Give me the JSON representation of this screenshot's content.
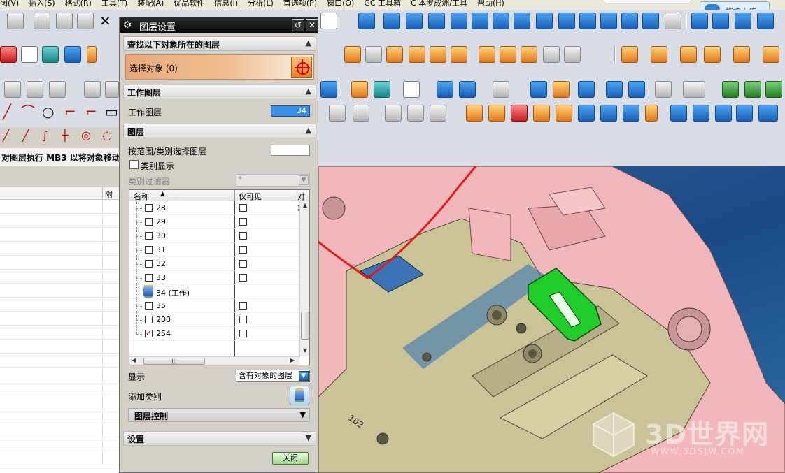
{
  "menubar": {
    "items": [
      "图(V)",
      "插入(S)",
      "格式(R)",
      "工具(T)",
      "装配(A)",
      "优品软件",
      "信息(I)",
      "分析(L)",
      "首选项(P)",
      "窗口(O)",
      "GC 工具箱",
      "C 本罗成洲/工具",
      "帮助(H)"
    ]
  },
  "upload_button": {
    "label": "拖拽上传"
  },
  "status_strip": {
    "text": "对图层执行 MB3 以将对象移动"
  },
  "navigator": {
    "column_label": "附"
  },
  "dialog": {
    "title": "图层设置",
    "section_find": {
      "label": "查找以下对象所在的图层",
      "select_label": "选择对象 (0)"
    },
    "section_work": {
      "label": "工作图层",
      "work_layer_label": "工作图层",
      "work_layer_value": "34"
    },
    "section_layer": {
      "label": "图层",
      "range_label": "按范围/类别选择图层",
      "category_display_label": "类别显示",
      "category_filter_label": "类别过滤器",
      "category_filter_value": "*",
      "columns": {
        "name": "名称",
        "visible_only": "仅可见",
        "objects": "对象"
      },
      "rows": [
        {
          "name": "28",
          "checked": false,
          "visible_only": false
        },
        {
          "name": "29",
          "checked": false,
          "visible_only": false
        },
        {
          "name": "30",
          "checked": false,
          "visible_only": false
        },
        {
          "name": "31",
          "checked": false,
          "visible_only": false
        },
        {
          "name": "32",
          "checked": false,
          "visible_only": false
        },
        {
          "name": "33",
          "checked": false,
          "visible_only": false
        },
        {
          "name": "34 (工作)",
          "checked": null,
          "visible_only": null
        },
        {
          "name": "35",
          "checked": false,
          "visible_only": false
        },
        {
          "name": "200",
          "checked": false,
          "visible_only": false
        },
        {
          "name": "254",
          "checked": true,
          "visible_only": false
        }
      ],
      "display_label": "显示",
      "display_value": "含有对象的图层",
      "add_category_label": "添加类别",
      "layer_control_label": "图层控制"
    },
    "section_settings": {
      "label": "设置"
    },
    "close_label": "关闭"
  },
  "viewport": {
    "part_label": "102"
  },
  "watermark": {
    "text": "3D世界网",
    "url": "WWW.3DSJW.COM"
  },
  "colors": {
    "accent": "#3b8fe8",
    "part": "#f2b7bb",
    "part_face": "#cbc398",
    "highlight": "#1fcc2a",
    "background": "#1a4b86"
  }
}
